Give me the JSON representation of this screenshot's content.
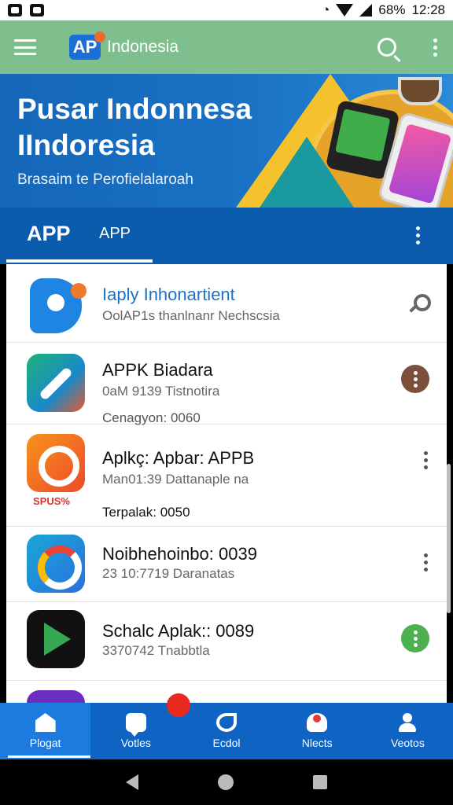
{
  "status_bar": {
    "battery": "68%",
    "time": "12:28"
  },
  "app_bar": {
    "logo_text": "AP",
    "title": "Indonesia"
  },
  "banner": {
    "title_line1": "Pusar Indonnesa",
    "title_line2": "IIndoresia",
    "subtitle": "Brasaim te Perofielalaroah"
  },
  "tabs": [
    {
      "label": "APP"
    },
    {
      "label": "APP"
    }
  ],
  "list": [
    {
      "title": "Iaply Inhonartient",
      "subtitle": "OolAP1s thanlnanr Nechscsia",
      "extra": "",
      "action": "key"
    },
    {
      "title": "APPK Biadara",
      "subtitle": "0aM 9139 Tistnotira",
      "extra": "Cenagyon: 0060",
      "action": "more-brown"
    },
    {
      "title": "Aplkç: Apbar: APPB",
      "subtitle": "Man01:39 Dattanaple na",
      "extra": "Terpalak: 0050",
      "tag": "SPUS%",
      "action": "kebab"
    },
    {
      "title": "Noibhehoinbo: 0039",
      "subtitle": "23 10:7719 Daranatas",
      "extra": "",
      "action": "kebab"
    },
    {
      "title": "Schalc Aplak:: 0089",
      "subtitle": "3370742 Tnabbtla",
      "extra": "",
      "action": "more-green"
    }
  ],
  "bottom_nav": [
    {
      "label": "Plogat",
      "icon": "home-icon"
    },
    {
      "label": "Votles",
      "icon": "chat-icon"
    },
    {
      "label": "Ecdol",
      "icon": "knot-icon"
    },
    {
      "label": "Nlects",
      "icon": "news-icon"
    },
    {
      "label": "Veotos",
      "icon": "person-icon"
    }
  ],
  "colors": {
    "app_bar": "#7fbf8d",
    "tabs": "#0b5cad",
    "bottom_nav": "#0f63c3",
    "accent_red": "#e8291e"
  }
}
